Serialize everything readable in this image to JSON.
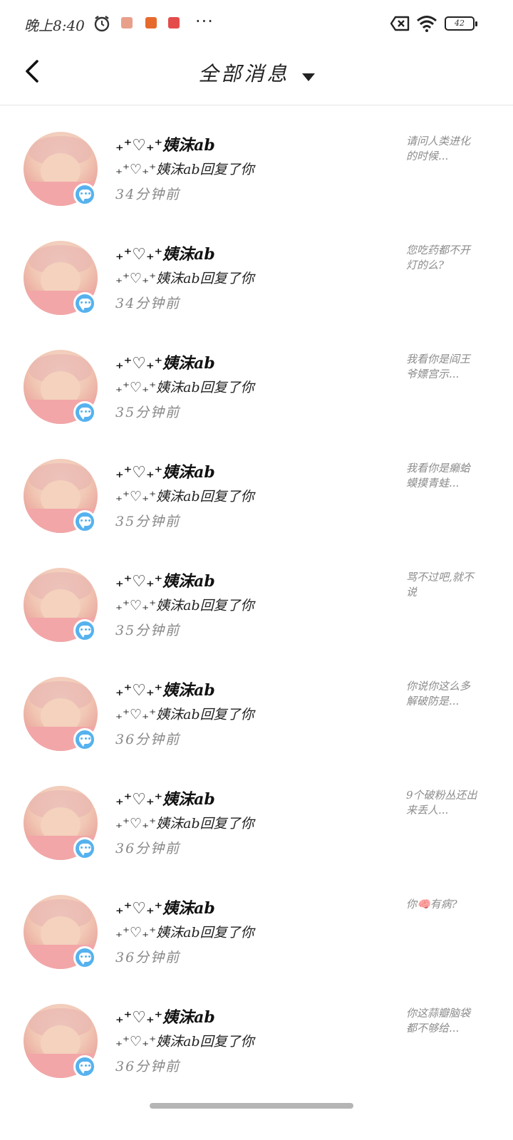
{
  "status_bar": {
    "time": "晚上8:40",
    "more": "···",
    "battery": "42"
  },
  "header": {
    "title": "全部消息"
  },
  "messages": [
    {
      "name": "₊⁺♡₊⁺姨沫ab",
      "action": "₊⁺♡₊⁺姨沫ab回复了你",
      "time": "34分钟前",
      "preview": "请问人类进化的时候..."
    },
    {
      "name": "₊⁺♡₊⁺姨沫ab",
      "action": "₊⁺♡₊⁺姨沫ab回复了你",
      "time": "34分钟前",
      "preview": "您吃药都不开灯的么?"
    },
    {
      "name": "₊⁺♡₊⁺姨沫ab",
      "action": "₊⁺♡₊⁺姨沫ab回复了你",
      "time": "35分钟前",
      "preview": "我看你是阎王爷嫖宫示..."
    },
    {
      "name": "₊⁺♡₊⁺姨沫ab",
      "action": "₊⁺♡₊⁺姨沫ab回复了你",
      "time": "35分钟前",
      "preview": "我看你是癞蛤蟆摸青蛙..."
    },
    {
      "name": "₊⁺♡₊⁺姨沫ab",
      "action": "₊⁺♡₊⁺姨沫ab回复了你",
      "time": "35分钟前",
      "preview": "骂不过吧,就不说"
    },
    {
      "name": "₊⁺♡₊⁺姨沫ab",
      "action": "₊⁺♡₊⁺姨沫ab回复了你",
      "time": "36分钟前",
      "preview": "你说你这么多解破防是..."
    },
    {
      "name": "₊⁺♡₊⁺姨沫ab",
      "action": "₊⁺♡₊⁺姨沫ab回复了你",
      "time": "36分钟前",
      "preview": "9个破粉丛还出来丢人..."
    },
    {
      "name": "₊⁺♡₊⁺姨沫ab",
      "action": "₊⁺♡₊⁺姨沫ab回复了你",
      "time": "36分钟前",
      "preview": "你🧠有病?"
    },
    {
      "name": "₊⁺♡₊⁺姨沫ab",
      "action": "₊⁺♡₊⁺姨沫ab回复了你",
      "time": "36分钟前",
      "preview": "你这蒜瓣脑袋都不够给..."
    }
  ]
}
